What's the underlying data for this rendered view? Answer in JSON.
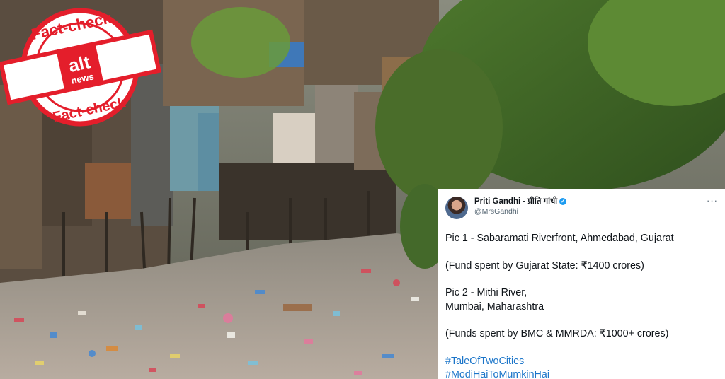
{
  "stamp": {
    "top_text": "Fact-check",
    "bottom_text": "Fact-check",
    "brand_line1": "alt",
    "brand_line2": "news"
  },
  "tweet": {
    "author_name": "Priti Gandhi - प्रीति गांधी",
    "handle": "@MrsGandhi",
    "more_glyph": "···",
    "lines": {
      "pic1": "Pic 1 - Sabaramati Riverfront, Ahmedabad, Gujarat",
      "fund1": "(Fund spent by Gujarat State: ₹1400 crores)",
      "pic2_a": "Pic 2 - Mithi River,",
      "pic2_b": "Mumbai, Maharashtra",
      "fund2": "(Funds spent by BMC & MMRDA: ₹1000+ crores)"
    },
    "hashtags": [
      "#TaleOfTwoCities",
      "#ModiHaiToMumkinHai"
    ]
  },
  "colors": {
    "stamp_red": "#e41e2b",
    "hashtag_blue": "#1b75c9",
    "verified_blue": "#1d9bf0"
  }
}
